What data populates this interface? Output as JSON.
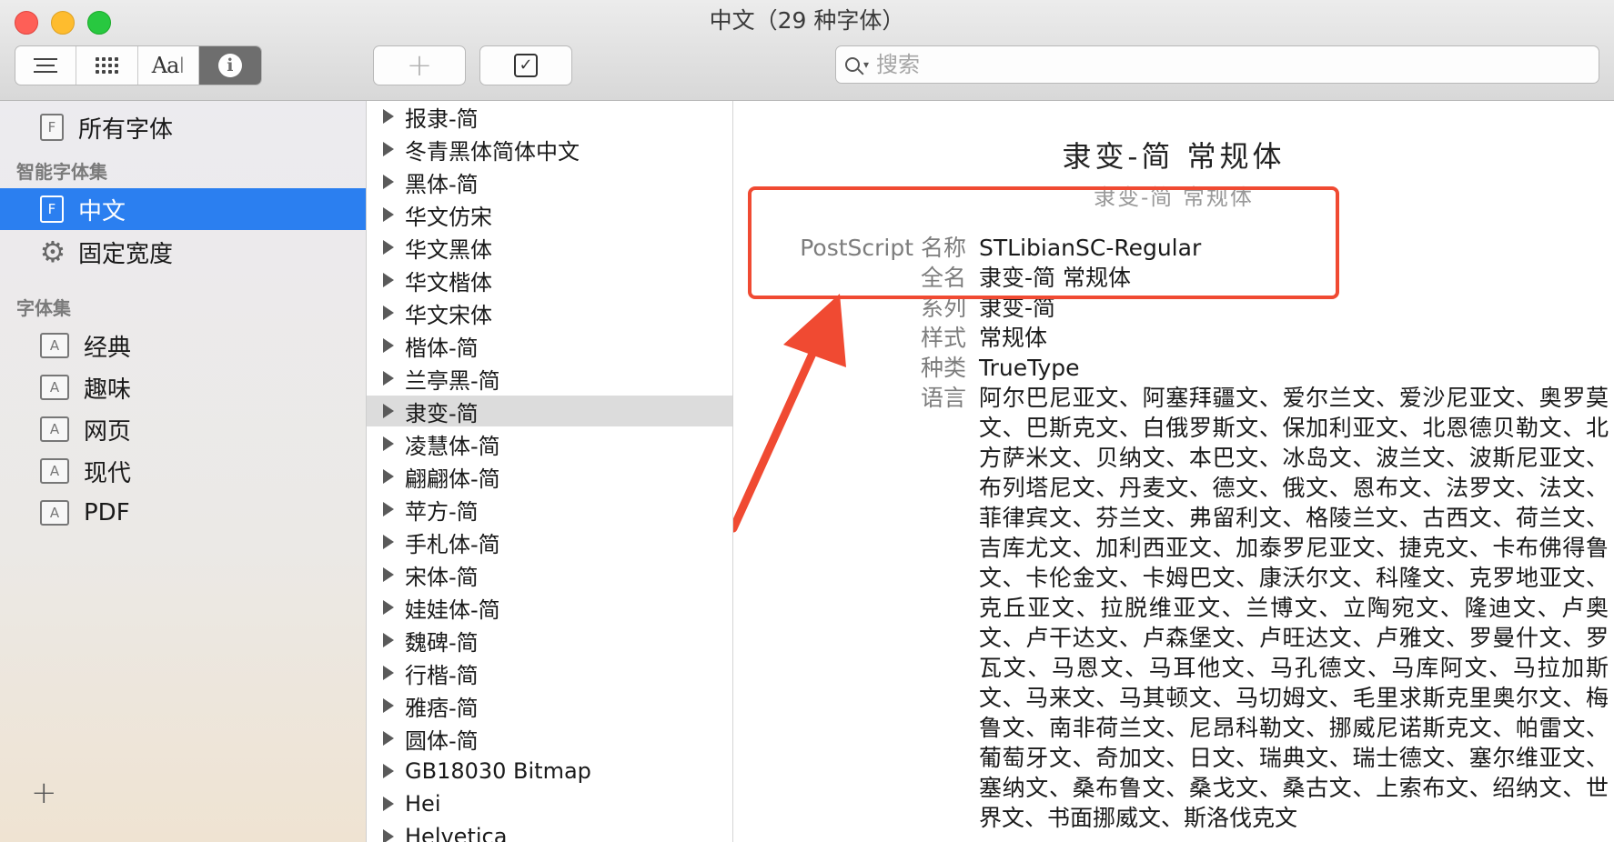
{
  "window": {
    "title": "中文（29 种字体）",
    "colors": {
      "close": "#fe5f57",
      "minimize": "#febc2e",
      "maximize": "#28c840"
    }
  },
  "toolbar": {
    "view_modes": [
      "list-view-icon",
      "grid-view-icon",
      "sample-view-icon",
      "info-view-icon"
    ],
    "aa_label": "Aa",
    "info_label": "i",
    "add_label": "+",
    "check_label": "✓",
    "search": {
      "placeholder": "搜索",
      "value": ""
    }
  },
  "sidebar": {
    "all_fonts": "所有字体",
    "smart_header": "智能字体集",
    "smart_items": [
      {
        "label": "中文",
        "icon": "font-collection-icon",
        "selected": true
      },
      {
        "label": "固定宽度",
        "icon": "gear-icon",
        "selected": false
      }
    ],
    "collections_header": "字体集",
    "collections": [
      "经典",
      "趣味",
      "网页",
      "现代",
      "PDF"
    ],
    "add_label": "+",
    "accent": "#2b7ff0"
  },
  "font_list": {
    "items": [
      "报隶-简",
      "冬青黑体简体中文",
      "黑体-简",
      "华文仿宋",
      "华文黑体",
      "华文楷体",
      "华文宋体",
      "楷体-简",
      "兰亭黑-简",
      "隶变-简",
      "凌慧体-简",
      "翩翩体-简",
      "苹方-简",
      "手札体-简",
      "宋体-简",
      "娃娃体-简",
      "魏碑-简",
      "行楷-简",
      "雅痞-简",
      "圆体-简",
      "GB18030 Bitmap",
      "Hei",
      "Helvetica"
    ],
    "selected": "隶变-简"
  },
  "detail": {
    "preview_large": "隶变-简 常规体",
    "preview_small": "隶变-简 常规体",
    "postscript_key": "PostScript 名称",
    "postscript_value": "STLibianSC-Regular",
    "fullname_key": "全名",
    "fullname_value": "隶变-简 常规体",
    "family_key": "系列",
    "family_value": "隶变-简",
    "style_key": "样式",
    "style_value": "常规体",
    "kind_key": "种类",
    "kind_value": "TrueType",
    "language_key": "语言",
    "language_value": "阿尔巴尼亚文、阿塞拜疆文、爱尔兰文、爱沙尼亚文、奥罗莫文、巴斯克文、白俄罗斯文、保加利亚文、北恩德贝勒文、北方萨米文、贝纳文、本巴文、冰岛文、波兰文、波斯尼亚文、布列塔尼文、丹麦文、德文、俄文、恩布文、法罗文、法文、菲律宾文、芬兰文、弗留利文、格陵兰文、古西文、荷兰文、吉库尤文、加利西亚文、加泰罗尼亚文、捷克文、卡布佛得鲁文、卡伦金文、卡姆巴文、康沃尔文、科隆文、克罗地亚文、克丘亚文、拉脱维亚文、兰博文、立陶宛文、隆迪文、卢奥文、卢干达文、卢森堡文、卢旺达文、卢雅文、罗曼什文、罗瓦文、马恩文、马耳他文、马孔德文、马库阿文、马拉加斯文、马来文、马其顿文、马切姆文、毛里求斯克里奥尔文、梅鲁文、南非荷兰文、尼昂科勒文、挪威尼诺斯克文、帕雷文、葡萄牙文、奇加文、日文、瑞典文、瑞士德文、塞尔维亚文、塞纳文、桑布鲁文、桑戈文、桑古文、上索布文、绍纳文、世界文、书面挪威文、斯洛伐克文",
    "annotation_color": "#f04a32"
  }
}
